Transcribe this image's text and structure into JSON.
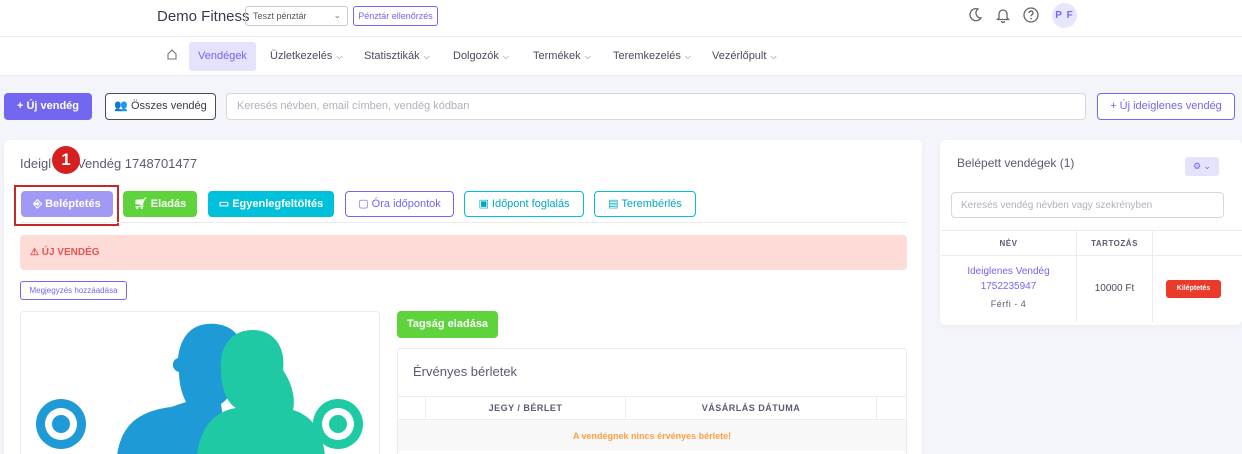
{
  "header": {
    "brand": "Demo Fitness",
    "cashbox_select": "Teszt pénztár",
    "cashbox_check_button": "Pénztár ellenőrzés",
    "user_initials": "P F"
  },
  "nav": {
    "items": [
      {
        "label": "Vendégek"
      },
      {
        "label": "Üzletkezelés"
      },
      {
        "label": "Statisztikák"
      },
      {
        "label": "Dolgozók"
      },
      {
        "label": "Termékek"
      },
      {
        "label": "Teremkezelés"
      },
      {
        "label": "Vezérlőpult"
      }
    ]
  },
  "toolbar": {
    "new_guest": "Új vendég",
    "all_guests": "Összes vendég",
    "search_placeholder": "Keresés névben, email címben, vendég kódban",
    "new_temp_guest": "Új ideiglenes vendég"
  },
  "guest": {
    "title_left": "Ideigl",
    "title_right": "Vendég 1748701477",
    "marker": "1",
    "actions": {
      "enter": "Beléptetés",
      "sale": "Eladás",
      "topup": "Egyenlegfeltöltés",
      "class_times": "Óra időpontok",
      "booking": "Időpont foglalás",
      "room_rental": "Terembérlés"
    },
    "alert": "ÚJ VENDÉG",
    "add_note": "Megjegyzés hozzáadása",
    "membership_sale": "Tagság eladása",
    "passes": {
      "title": "Érvényes bérletek",
      "columns": [
        "JEGY / BÉRLET",
        "VÁSÁRLÁS DÁTUMA"
      ],
      "empty": "A vendégnek nincs érvényes bérlete!"
    }
  },
  "checked_in": {
    "title": "Belépett vendégek (1)",
    "search_placeholder": "Keresés vendég névben vagy szekrényben",
    "columns": [
      "NÉV",
      "TARTOZÁS"
    ],
    "rows": [
      {
        "name": "Ideiglenes Vendég 1752235947",
        "sub": "Férfi - 4",
        "debt": "10000 Ft",
        "action": "Kiléptetés"
      }
    ]
  },
  "colors": {
    "primary": "#7367f0",
    "success": "#5fd33c",
    "info": "#00c1db",
    "danger": "#ea5455",
    "warning": "#ff9f43",
    "figure_blue": "#1e9ad6",
    "figure_green": "#1fc9a4"
  }
}
